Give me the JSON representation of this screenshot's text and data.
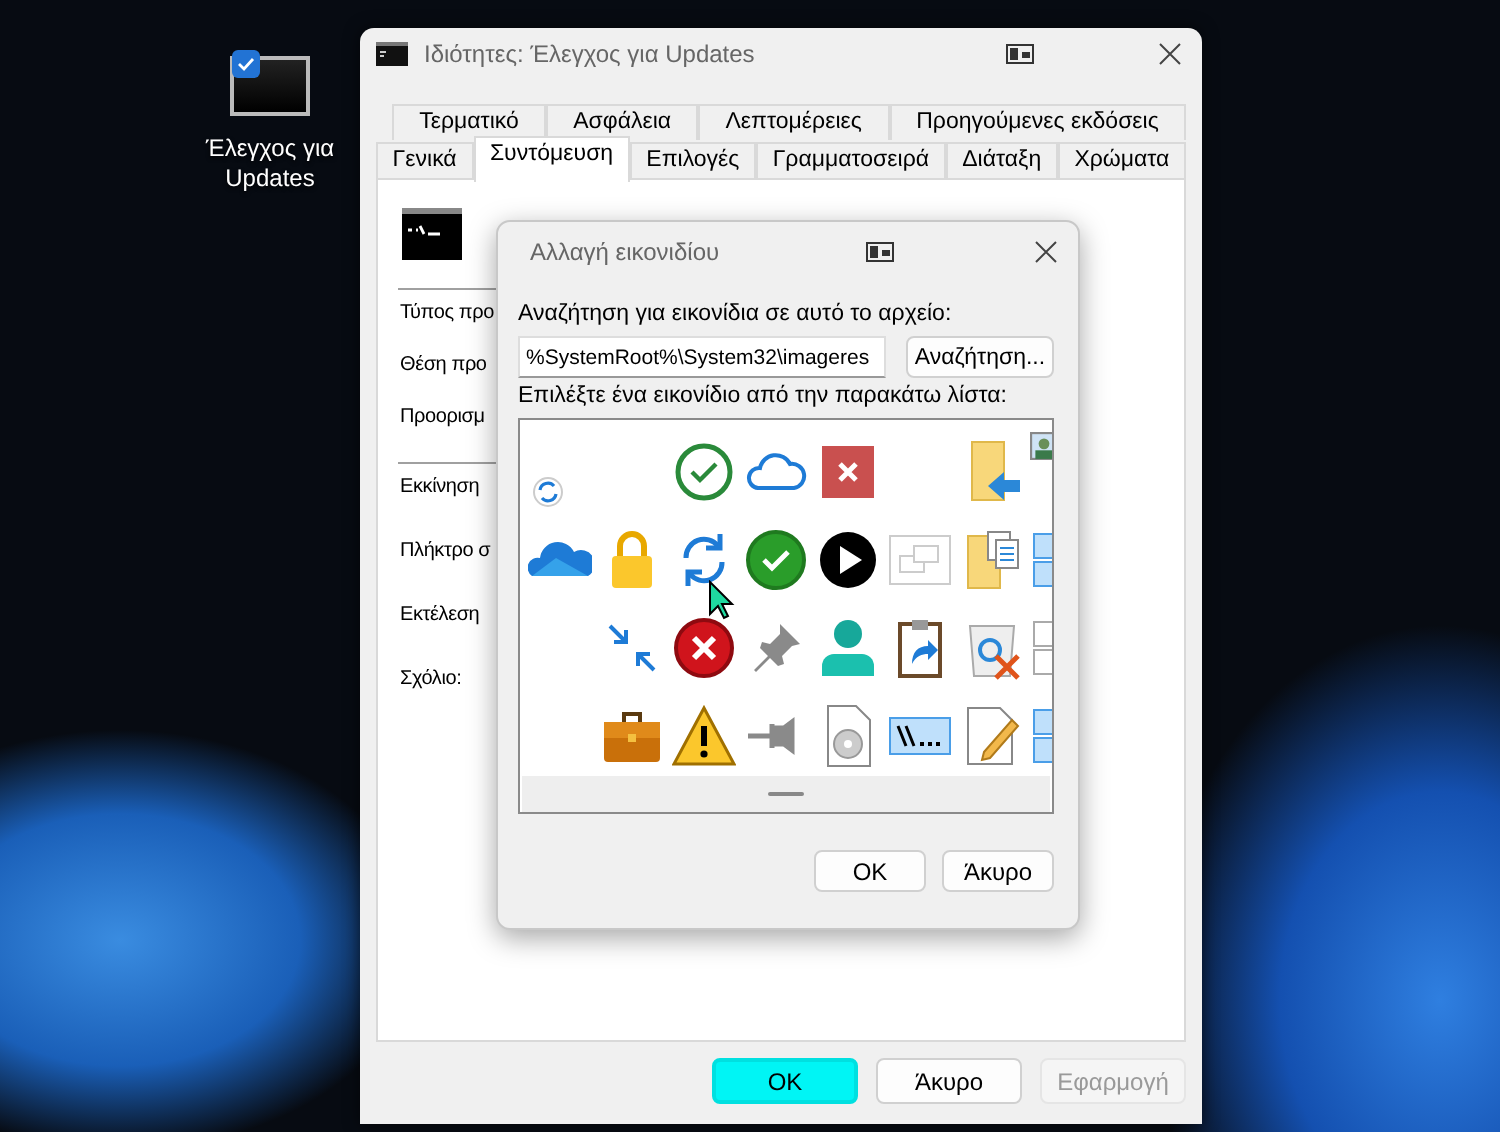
{
  "desktop_icon": {
    "label": "Έλεγχος για Updates",
    "checked": true
  },
  "window": {
    "title": "Ιδιότητες: Έλεγχος για Updates"
  },
  "tabs_back": [
    {
      "label": "Τερματικό",
      "selected": false
    },
    {
      "label": "Ασφάλεια",
      "selected": false
    },
    {
      "label": "Λεπτομέρειες",
      "selected": false
    },
    {
      "label": "Προηγούμενες εκδόσεις",
      "selected": false
    }
  ],
  "tabs_front": [
    {
      "label": "Γενικά",
      "selected": false
    },
    {
      "label": "Συντόμευση",
      "selected": true
    },
    {
      "label": "Επιλογές",
      "selected": false
    },
    {
      "label": "Γραμματοσειρά",
      "selected": false
    },
    {
      "label": "Διάταξη",
      "selected": false
    },
    {
      "label": "Χρώματα",
      "selected": false
    }
  ],
  "fields_top": [
    "Τύπος προ",
    "Θέση προ",
    "Προορισμ"
  ],
  "fields_bottom": [
    "Εκκίνηση",
    "Πλήκτρο σ",
    "Εκτέλεση",
    "Σχόλιο:"
  ],
  "buttons": [
    {
      "label": "OK",
      "focused": true,
      "disabled": false
    },
    {
      "label": "Άκυρο",
      "focused": false,
      "disabled": false
    },
    {
      "label": "Εφαρμογή",
      "focused": false,
      "disabled": true
    }
  ],
  "dialog": {
    "title": "Αλλαγή εικονιδίου",
    "file_label": "Αναζήτηση για εικονίδια σε αυτό το αρχείο:",
    "file_value": "%SystemRoot%\\System32\\imageres",
    "browse": "Αναζήτηση...",
    "list_label": "Επιλέξτε ένα εικονίδιο από την παρακάτω λίστα:",
    "icons": [
      {
        "kind": "sync-small"
      },
      {
        "kind": "blank"
      },
      {
        "kind": "check-outline"
      },
      {
        "kind": "cloud"
      },
      {
        "kind": "x-square"
      },
      {
        "kind": "blank"
      },
      {
        "kind": "folder-arrow"
      },
      {
        "kind": "photo"
      },
      {
        "kind": "onedrive"
      },
      {
        "kind": "lock"
      },
      {
        "kind": "sync"
      },
      {
        "kind": "check-green"
      },
      {
        "kind": "play"
      },
      {
        "kind": "windows"
      },
      {
        "kind": "folder-docs"
      },
      {
        "kind": "panel"
      },
      {
        "kind": "blank"
      },
      {
        "kind": "arrows-in"
      },
      {
        "kind": "x-circle"
      },
      {
        "kind": "pin"
      },
      {
        "kind": "person"
      },
      {
        "kind": "clipboard"
      },
      {
        "kind": "recycle-x"
      },
      {
        "kind": "checkbox"
      },
      {
        "kind": "blank"
      },
      {
        "kind": "briefcase"
      },
      {
        "kind": "warning"
      },
      {
        "kind": "pin-side"
      },
      {
        "kind": "disc-file"
      },
      {
        "kind": "network-path"
      },
      {
        "kind": "edit-doc"
      },
      {
        "kind": "panel"
      }
    ],
    "buttons": [
      "OK",
      "Άκυρο"
    ]
  }
}
